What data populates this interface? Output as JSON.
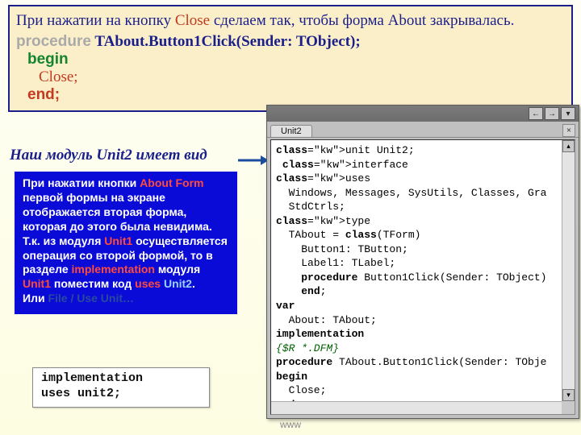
{
  "topbox": {
    "line1a": "При нажатии на кнопку ",
    "close": "Close",
    "line1b": "  сделаем так, чтобы форма About закрывалась.",
    "proc_kw": " procedure",
    "proc_sig": " TAbout.Button1Click(Sender: TObject);",
    "begin": "begin",
    "close_call": "Close;",
    "end": "end;"
  },
  "subhead": "Наш модуль Unit2 имеет вид",
  "bluebox": {
    "t1": "      При  нажатии  кнопки ",
    "af": "About Form",
    "t2": " первой формы на экране отображается вторая форма, которая до этого была невидима.",
    "t3": "      Т.к.  из  модуля ",
    "u1": "Unit1",
    "t4": " осуществляется операция со второй формой, то в разделе ",
    "impl": "implementation",
    "t5": " модуля ",
    "u1b": "Unit1",
    "t6": " поместим  код ",
    "uses": "uses ",
    "u2": "Unit2",
    "dot": ".",
    "t7": "Или ",
    "fu": "File / Use Unit…"
  },
  "snippet": {
    "l1": "implementation",
    "l2": "  uses unit2;"
  },
  "editor": {
    "tab": "Unit2",
    "nav": {
      "back": "←",
      "fwd": "→",
      "drop": "▾"
    },
    "close": "×",
    "scroll": {
      "up": "▴",
      "down": "▾"
    },
    "code": "unit Unit2;\n interface\nuses\n  Windows, Messages, SysUtils, Classes, Gra\n  StdCtrls;\ntype\n  TAbout = class(TForm)\n    Button1: TButton;\n    Label1: TLabel;\n    procedure Button1Click(Sender: TObject)\n    end;\nvar\n  About: TAbout;\nimplementation\n{$R *.DFM}\nprocedure TAbout.Button1Click(Sender: TObje\nbegin\n  Close;\nend;\nend."
  },
  "footer": "www"
}
